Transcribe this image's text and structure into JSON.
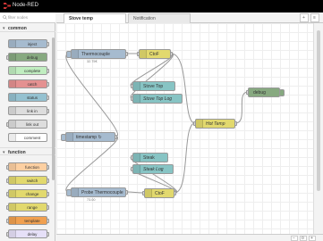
{
  "app": {
    "title": "Node-RED"
  },
  "palette": {
    "filter_placeholder": "filter nodes",
    "categories": [
      {
        "label": "common",
        "nodes": [
          {
            "label": "inject",
            "color": "#a6bbcf"
          },
          {
            "label": "debug",
            "color": "#87a980"
          },
          {
            "label": "complete",
            "color": "#c0edc0"
          },
          {
            "label": "catch",
            "color": "#e49191"
          },
          {
            "label": "status",
            "color": "#94c1d0"
          },
          {
            "label": "link in",
            "color": "#dddddd"
          },
          {
            "label": "link out",
            "color": "#dddddd"
          },
          {
            "label": "comment",
            "color": "#ffffff"
          }
        ]
      },
      {
        "label": "function",
        "nodes": [
          {
            "label": "function",
            "color": "#fdd0a2"
          },
          {
            "label": "switch",
            "color": "#e2d96e"
          },
          {
            "label": "change",
            "color": "#e2d96e"
          },
          {
            "label": "range",
            "color": "#e2d96e"
          },
          {
            "label": "template",
            "color": "#f0a050"
          },
          {
            "label": "delay",
            "color": "#e6e0f8"
          }
        ]
      }
    ]
  },
  "tabs": [
    {
      "label": "Stove temp",
      "active": true
    },
    {
      "label": "Notification",
      "active": false
    }
  ],
  "tab_buttons": {
    "add": "+",
    "menu": "≡"
  },
  "flow": {
    "nodes": {
      "thermocouple": {
        "label": "Thermocouple",
        "status": "32.75€",
        "color": "#a6bbcf"
      },
      "ctof_top": {
        "label": "CtoF",
        "color": "#e2d96e"
      },
      "stove_top": {
        "label": "Stove Top",
        "color": "#87c4c4"
      },
      "stove_top_log": {
        "label": "Stove Top Log",
        "color": "#87c4c4"
      },
      "hot_temp": {
        "label": "Hot Temp",
        "color": "#e2d96e"
      },
      "debug": {
        "label": "debug",
        "color": "#87a980"
      },
      "timestamp": {
        "label": "timestamp ↻",
        "color": "#a6bbcf"
      },
      "steak": {
        "label": "Steak",
        "color": "#87c4c4"
      },
      "steak_log": {
        "label": "Steak Log",
        "color": "#87c4c4"
      },
      "probe_thermocouple": {
        "label": "Probe Thermocouple",
        "status": "73.00",
        "color": "#a6bbcf"
      },
      "ctof_bottom": {
        "label": "CtoF",
        "color": "#e2d96e"
      }
    }
  },
  "footer": {
    "minus": "−",
    "reset": "o",
    "plus": "+"
  }
}
